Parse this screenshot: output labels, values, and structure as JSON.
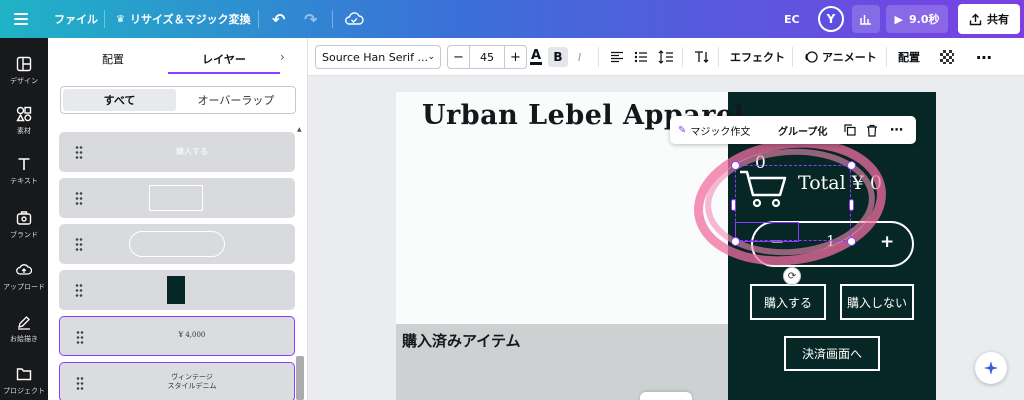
{
  "topbar": {
    "file_label": "ファイル",
    "resize_label": "リサイズ＆マジック変換",
    "ec_label": "EC",
    "avatar_initial": "Y",
    "timer_label": "9.0秒",
    "share_label": "共有"
  },
  "rail": {
    "items": [
      {
        "label": "デザイン",
        "icon": "layout-icon"
      },
      {
        "label": "素材",
        "icon": "elements-icon"
      },
      {
        "label": "テキスト",
        "icon": "text-icon"
      },
      {
        "label": "ブランド",
        "icon": "brand-icon"
      },
      {
        "label": "アップロード",
        "icon": "upload-icon"
      },
      {
        "label": "お絵描き",
        "icon": "draw-icon"
      },
      {
        "label": "プロジェクト",
        "icon": "folder-icon"
      }
    ]
  },
  "panel": {
    "tab_arrange": "配置",
    "tab_layers": "レイヤー",
    "seg_all": "すべて",
    "seg_overlap": "オーバーラップ",
    "layers": [
      {
        "text": "購入する"
      },
      {
        "text": ""
      },
      {
        "text": ""
      },
      {
        "text": ""
      },
      {
        "text": "¥ 4,000"
      },
      {
        "text": "ヴィンテージ\nスタイルデニム"
      }
    ]
  },
  "format": {
    "font_name": "Source Han Serif ...",
    "font_size": "45",
    "effects_label": "エフェクト",
    "animate_label": "アニメート",
    "position_label": "配置"
  },
  "canvas": {
    "title": "Urban Lebel Apparel",
    "purchased_items": "購入済みアイテム",
    "cart_count": "0",
    "total_text": "Total ¥ 0",
    "qty_minus": "−",
    "qty_value": "1",
    "qty_plus": "+",
    "buy_label": "購入する",
    "no_buy_label": "購入しない",
    "checkout_label": "決済画面へ"
  },
  "floatbar": {
    "magic_label": "マジック作文",
    "group_label": "グループ化"
  },
  "colors": {
    "accent": "#8b3dff",
    "dark_panel": "#062725",
    "annotation": "#f06ea0"
  }
}
